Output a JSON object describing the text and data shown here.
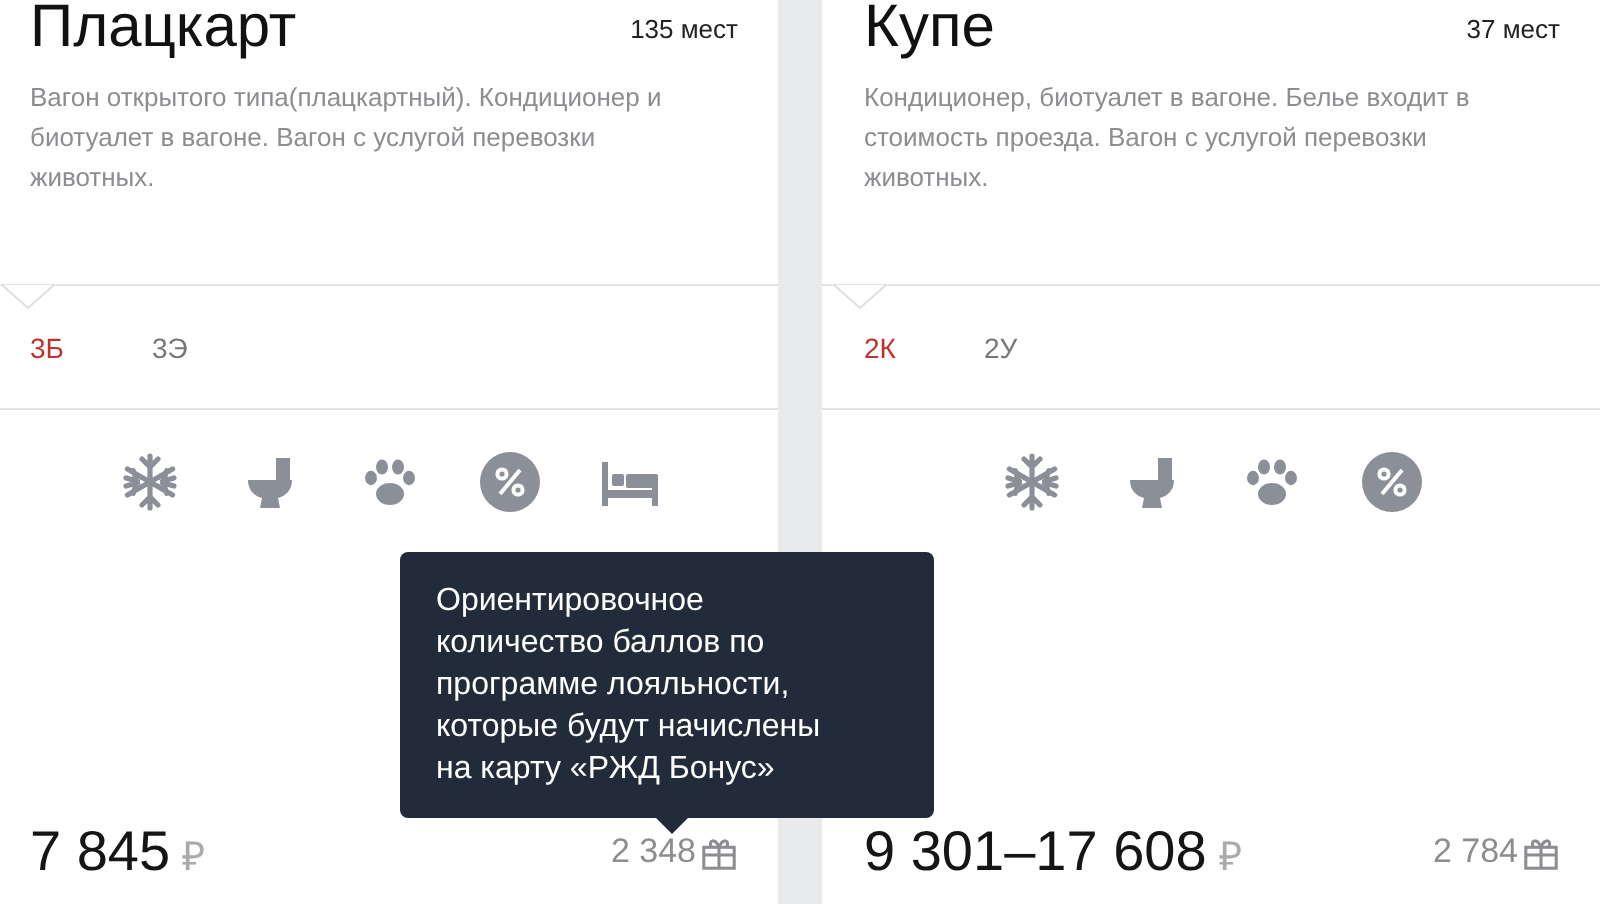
{
  "cars": [
    {
      "title": "Плацкарт",
      "seats": "135 мест",
      "description": "Вагон открытого типа(плацкартный). Кондиционер и биотуалет в вагоне. Вагон с услугой перевозки животных.",
      "classes": [
        {
          "label": "3Б",
          "selected": true
        },
        {
          "label": "3Э",
          "selected": false
        }
      ],
      "amenities": [
        {
          "kind": "snowflake"
        },
        {
          "kind": "toilet"
        },
        {
          "kind": "paw"
        },
        {
          "kind": "discount"
        },
        {
          "kind": "bed"
        }
      ],
      "price": "7 845",
      "currency": "₽",
      "bonus": "2 348",
      "tooltip": "Ориентировочное\nколичество баллов по\nпрограмме лояльности,\nкоторые будут начислены\nна карту «РЖД Бонус»"
    },
    {
      "title": "Купе",
      "seats": "37 мест",
      "description": "Кондиционер, биотуалет в вагоне. Белье входит в стоимость проезда. Вагон с услугой перевозки животных.",
      "classes": [
        {
          "label": "2К",
          "selected": true
        },
        {
          "label": "2У",
          "selected": false
        }
      ],
      "amenities": [
        {
          "kind": "snowflake"
        },
        {
          "kind": "toilet"
        },
        {
          "kind": "paw"
        },
        {
          "kind": "discount"
        }
      ],
      "price": "9 301–17 608",
      "currency": "₽",
      "bonus": "2 784"
    }
  ]
}
